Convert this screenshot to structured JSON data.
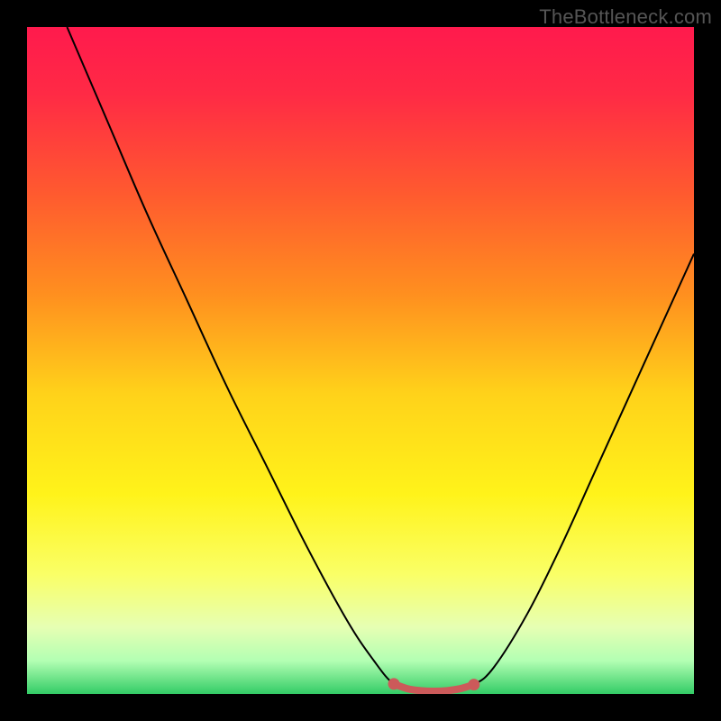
{
  "watermark": "TheBottleneck.com",
  "chart_data": {
    "type": "line",
    "title": "",
    "xlabel": "",
    "ylabel": "",
    "xlim": [
      0,
      100
    ],
    "ylim": [
      0,
      100
    ],
    "gradient_stops": [
      {
        "offset": 0,
        "color": "#ff1a4d"
      },
      {
        "offset": 0.1,
        "color": "#ff2a45"
      },
      {
        "offset": 0.25,
        "color": "#ff5a2f"
      },
      {
        "offset": 0.4,
        "color": "#ff8f1f"
      },
      {
        "offset": 0.55,
        "color": "#ffd21a"
      },
      {
        "offset": 0.7,
        "color": "#fff31a"
      },
      {
        "offset": 0.82,
        "color": "#faff66"
      },
      {
        "offset": 0.9,
        "color": "#e6ffb3"
      },
      {
        "offset": 0.95,
        "color": "#b3ffb3"
      },
      {
        "offset": 1.0,
        "color": "#33cc66"
      }
    ],
    "series": [
      {
        "name": "bottleneck-curve",
        "color": "#000000",
        "points": [
          {
            "x": 6,
            "y": 100
          },
          {
            "x": 12,
            "y": 86
          },
          {
            "x": 18,
            "y": 72
          },
          {
            "x": 24,
            "y": 59
          },
          {
            "x": 30,
            "y": 46
          },
          {
            "x": 36,
            "y": 34
          },
          {
            "x": 42,
            "y": 22
          },
          {
            "x": 48,
            "y": 11
          },
          {
            "x": 52,
            "y": 5
          },
          {
            "x": 55,
            "y": 1.5
          },
          {
            "x": 58,
            "y": 0.6
          },
          {
            "x": 61,
            "y": 0.4
          },
          {
            "x": 64,
            "y": 0.5
          },
          {
            "x": 67,
            "y": 1.4
          },
          {
            "x": 70,
            "y": 4
          },
          {
            "x": 75,
            "y": 12
          },
          {
            "x": 80,
            "y": 22
          },
          {
            "x": 85,
            "y": 33
          },
          {
            "x": 90,
            "y": 44
          },
          {
            "x": 95,
            "y": 55
          },
          {
            "x": 100,
            "y": 66
          }
        ]
      },
      {
        "name": "flat-region-marker",
        "color": "#cc5a5a",
        "points": [
          {
            "x": 55,
            "y": 1.5
          },
          {
            "x": 57,
            "y": 0.8
          },
          {
            "x": 59,
            "y": 0.5
          },
          {
            "x": 61,
            "y": 0.4
          },
          {
            "x": 63,
            "y": 0.5
          },
          {
            "x": 65,
            "y": 0.8
          },
          {
            "x": 67,
            "y": 1.4
          }
        ],
        "endpoints": [
          {
            "x": 55,
            "y": 1.5
          },
          {
            "x": 67,
            "y": 1.4
          }
        ]
      }
    ]
  }
}
